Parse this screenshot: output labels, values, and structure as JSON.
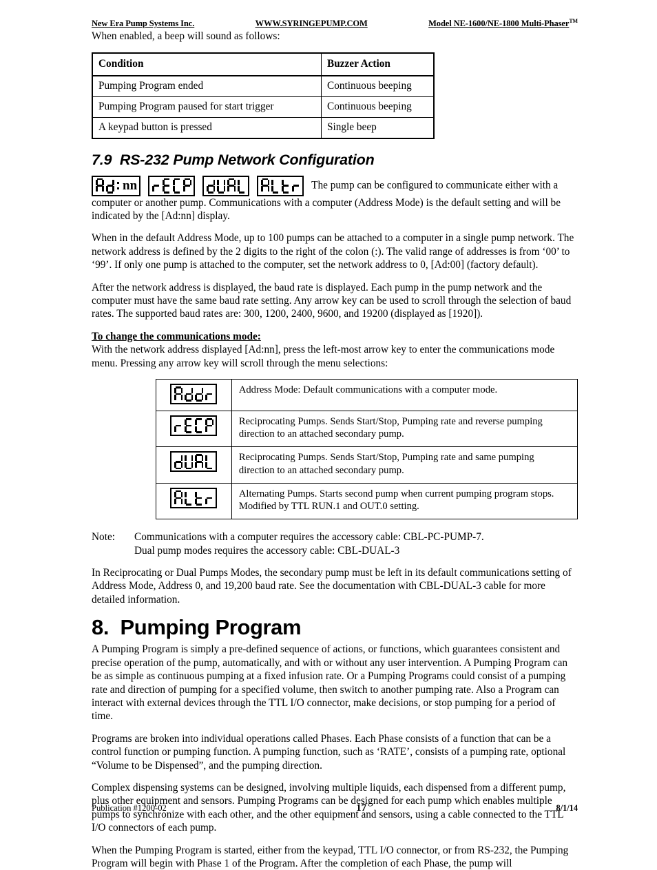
{
  "runhead": {
    "left": "New Era Pump Systems Inc.",
    "center": "WWW.SYRINGEPUMP.COM",
    "right": "Model NE-1600/NE-1800 Multi-Phaser",
    "right_tm": "TM"
  },
  "intro_line": "When enabled, a beep will sound as follows:",
  "buzzer_table": {
    "headers": [
      "Condition",
      "Buzzer Action"
    ],
    "rows": [
      [
        "Pumping Program ended",
        "Continuous beeping"
      ],
      [
        "Pumping Program paused for start trigger",
        "Continuous beeping"
      ],
      [
        "A keypad button is pressed",
        "Single beep"
      ]
    ]
  },
  "section": {
    "number": "7.9",
    "title": "RS-232 Pump Network Configuration"
  },
  "lcd_row": {
    "displays": [
      {
        "name": "lcd-ad-nn",
        "segments": "Ad",
        "colon": true,
        "text": "nn"
      },
      {
        "name": "lcd-recp",
        "segments": "rECP"
      },
      {
        "name": "lcd-dual",
        "segments": "dUAL"
      },
      {
        "name": "lcd-altr",
        "segments": "ALtr"
      }
    ],
    "trailing_text": "The pump can be configured to communicate either with a computer or another pump.  Communications with a computer (Address Mode) is the default setting and will be indicated by the [Ad:nn] display."
  },
  "paragraphs": {
    "address_mode": "When in the default Address Mode, up to 100 pumps can be attached to a computer in a single pump network.  The network address is defined by the 2 digits to the right of the colon (:).  The valid range of addresses is from ‘00’ to ‘99’.  If only one pump is attached to the computer, set the network address to 0, [Ad:00] (factory default).",
    "baud_rate": "After the network address is displayed, the baud rate is displayed.  Each pump in the pump network and the computer must have the same baud rate setting.  Any arrow key can be used to scroll through the selection of baud rates.  The supported baud rates are:  300, 1200, 2400, 9600, and 19200 (displayed as [1920]).",
    "change_mode_heading": "To change the communications mode:",
    "change_mode_body": "With the network address displayed [Ad:nn], press the left-most arrow key to enter the communications mode menu.  Pressing any arrow key will scroll through the menu selections:",
    "secondary_pump": "In Reciprocating or Dual Pumps Modes, the secondary pump must be left in its default communications setting of Address Mode, Address 0, and 19,200 baud rate.  See the documentation with CBL-DUAL-3 cable for more detailed information."
  },
  "modes_table": {
    "rows": [
      {
        "lcd": "Addr",
        "desc": "Address Mode:  Default communications with a computer mode."
      },
      {
        "lcd": "rECP",
        "desc": "Reciprocating Pumps.  Sends Start/Stop, Pumping rate and reverse pumping direction to an attached secondary pump."
      },
      {
        "lcd": "dUAL",
        "desc": "Reciprocating Pumps.  Sends Start/Stop, Pumping rate and same pumping direction to an attached secondary pump."
      },
      {
        "lcd": "ALtr",
        "desc": "Alternating Pumps.  Starts second pump when current pumping program stops.  Modified by TTL RUN.1 and OUT.0 setting."
      }
    ]
  },
  "note": {
    "label": "Note:",
    "line1": "Communications with a computer requires the accessory cable:  CBL-PC-PUMP-7.",
    "line2": "Dual pump modes requires the accessory cable:  CBL-DUAL-3"
  },
  "chapter": {
    "number": "8.",
    "title": "Pumping Program"
  },
  "chapter_paragraphs": [
    "A Pumping Program is simply a pre-defined sequence of actions, or functions, which guarantees consistent and precise operation of the pump, automatically, and with or without any user intervention.  A Pumping Program can be as simple as continuous pumping at a fixed infusion rate.  Or a Pumping Programs could consist of a pumping rate and direction of pumping for a specified volume, then switch to another pumping rate.  Also a Program can interact with external devices through the TTL I/O connector, make decisions, or stop pumping for a period of time.",
    "Programs are broken into individual operations called Phases.  Each Phase consists of a function that can be a control function or pumping function.  A pumping function, such as ‘RATE’, consists of a pumping rate, optional “Volume to be Dispensed”, and the pumping direction.",
    "Complex dispensing systems can be designed, involving multiple liquids, each dispensed from a different pump, plus other equipment and sensors.  Pumping Programs can be designed for each pump which enables multiple pumps to synchronize with each other, and the other equipment and sensors, using a cable connected to the TTL I/O connectors of each pump.",
    "When the Pumping Program is started, either from the keypad, TTL I/O connector, or from RS-232, the Pumping Program will begin with Phase 1 of the Program.  After the completion of each Phase, the pump will"
  ],
  "footer": {
    "publication": "Publication  #1200-02",
    "page": "17",
    "date": "8/1/14"
  }
}
